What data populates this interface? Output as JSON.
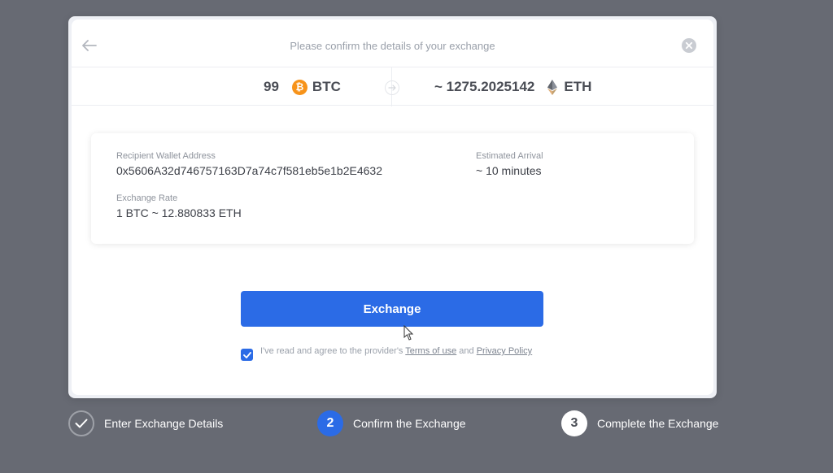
{
  "header": {
    "title": "Please confirm the details of your exchange"
  },
  "summary": {
    "from_amount": "99",
    "from_symbol": "BTC",
    "to_amount": "~ 1275.2025142",
    "to_symbol": "ETH"
  },
  "details": {
    "wallet_label": "Recipient Wallet Address",
    "wallet_value": "0x5606A32d746757163D7a74c7f581eb5e1b2E4632",
    "arrival_label": "Estimated Arrival",
    "arrival_value": "~ 10 minutes",
    "rate_label": "Exchange Rate",
    "rate_value": "1 BTC  ~ 12.880833 ETH"
  },
  "actions": {
    "exchange_label": "Exchange",
    "agree_prefix": "I've read and agree to the provider's ",
    "terms_label": "Terms of use",
    "and_text": " and ",
    "privacy_label": "Privacy Policy",
    "agree_checked": true
  },
  "steps": [
    {
      "number": "",
      "label": "Enter Exchange Details",
      "state": "done"
    },
    {
      "number": "2",
      "label": "Confirm the Exchange",
      "state": "active"
    },
    {
      "number": "3",
      "label": "Complete the Exchange",
      "state": "pending"
    }
  ],
  "colors": {
    "accent": "#2b6be6",
    "btc": "#f7931a",
    "backdrop": "#676a73"
  },
  "icons": {
    "back": "arrow-left-icon",
    "close": "close-circle-icon",
    "btc": "bitcoin-icon",
    "eth": "ethereum-icon",
    "swap": "arrow-right-icon",
    "check": "checkmark-icon"
  }
}
